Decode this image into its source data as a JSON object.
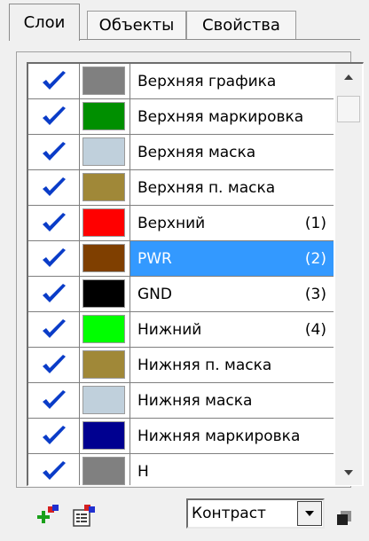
{
  "tabs": [
    {
      "label": "Слои",
      "active": true
    },
    {
      "label": "Объекты",
      "active": false
    },
    {
      "label": "Свойства",
      "active": false
    }
  ],
  "layers": [
    {
      "checked": true,
      "color": "#808080",
      "name": "Верхняя графика",
      "num": ""
    },
    {
      "checked": true,
      "color": "#008f00",
      "name": "Верхняя маркировка",
      "num": ""
    },
    {
      "checked": true,
      "color": "#c0d0dc",
      "name": "Верхняя маска",
      "num": ""
    },
    {
      "checked": true,
      "color": "#a08838",
      "name": "Верхняя п. маска",
      "num": ""
    },
    {
      "checked": true,
      "color": "#ff0000",
      "name": "Верхний",
      "num": "(1)"
    },
    {
      "checked": true,
      "color": "#7f3f00",
      "name": "PWR",
      "num": "(2)",
      "selected": true
    },
    {
      "checked": true,
      "color": "#000000",
      "name": "GND",
      "num": "(3)"
    },
    {
      "checked": true,
      "color": "#00ff00",
      "name": "Нижний",
      "num": "(4)"
    },
    {
      "checked": true,
      "color": "#a08838",
      "name": "Нижняя п. маска",
      "num": ""
    },
    {
      "checked": true,
      "color": "#c0d0dc",
      "name": "Нижняя маска",
      "num": ""
    },
    {
      "checked": true,
      "color": "#000090",
      "name": "Нижняя маркировка",
      "num": ""
    },
    {
      "checked": true,
      "color": "#808080",
      "name": "Н",
      "num": ""
    }
  ],
  "scrollbar": {
    "up_icon": "arrow-up-icon",
    "down_icon": "arrow-down-icon",
    "position": 0.0
  },
  "toolbar": {
    "add_layer_icon": "add-layer-icon",
    "layer_properties_icon": "layer-properties-icon",
    "mode_value": "Контраст",
    "mode_dropdown_icon": "chevron-down-icon",
    "extra_icon": "layers-stack-icon"
  },
  "colors": {
    "selection": "#3399ff",
    "check": "#0a3cc8"
  }
}
